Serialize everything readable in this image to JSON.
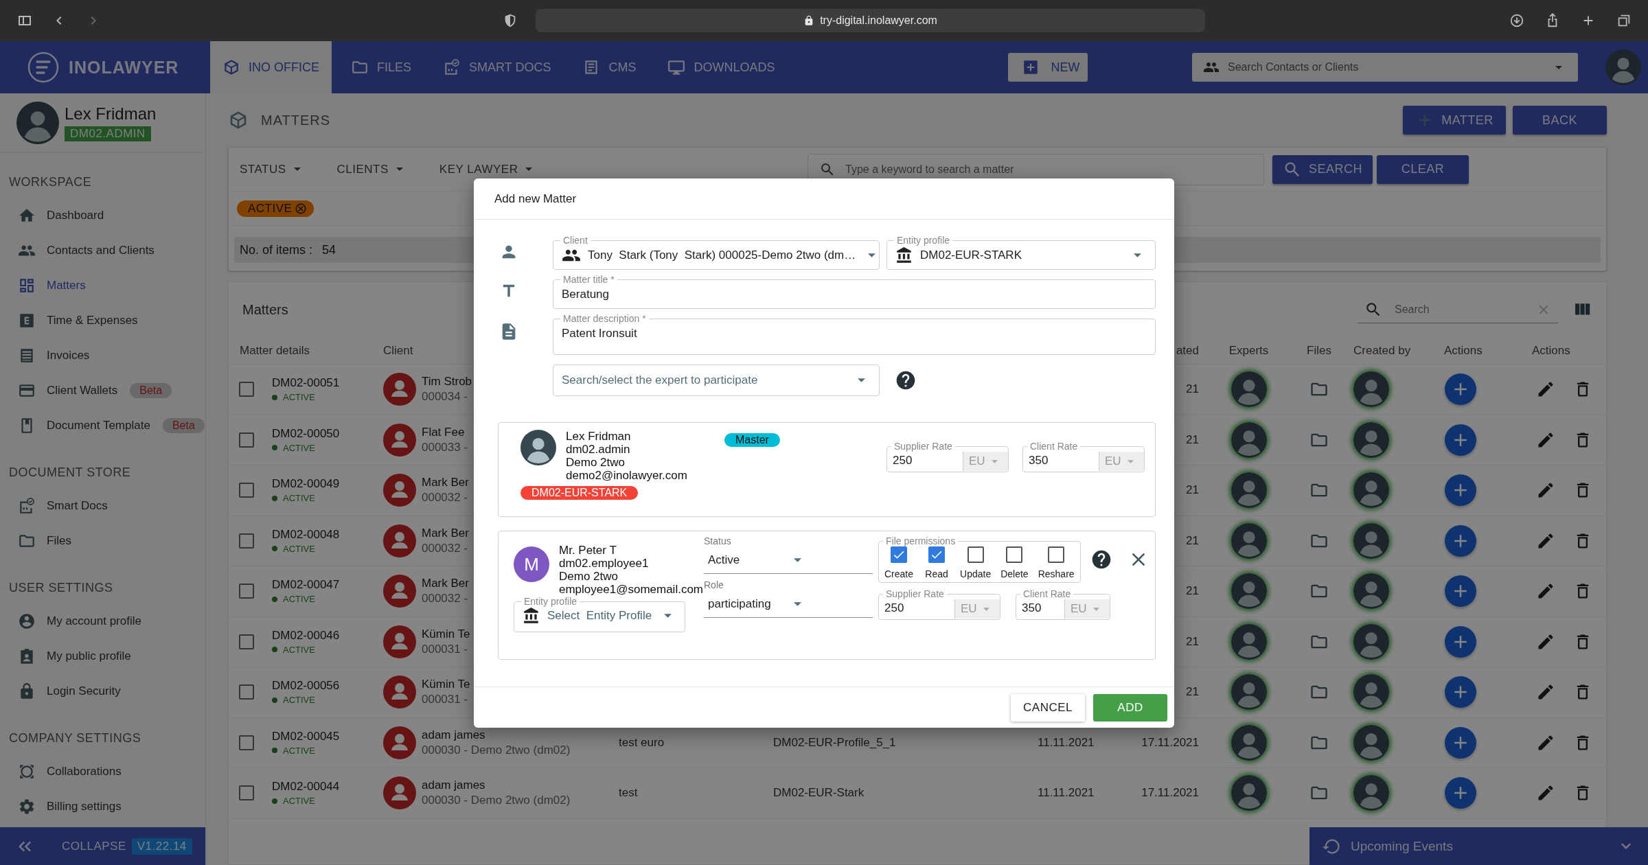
{
  "browser": {
    "url": "try-digital.inolawyer.com"
  },
  "nav": {
    "logo": "INOLAWYER",
    "tabs": [
      {
        "label": "INO OFFICE",
        "selected": true
      },
      {
        "label": "FILES",
        "selected": false
      },
      {
        "label": "SMART DOCS",
        "selected": false
      },
      {
        "label": "CMS",
        "selected": false
      },
      {
        "label": "DOWNLOADS",
        "selected": false
      }
    ],
    "new_button": "NEW",
    "search": {
      "placeholder": "Search Contacts or Clients"
    }
  },
  "sidebar": {
    "user": {
      "name": "Lex Fridman",
      "role": "DM02.ADMIN"
    },
    "sections": [
      {
        "title": "WORKSPACE",
        "items": [
          {
            "label": "Dashboard",
            "selected": false
          },
          {
            "label": "Contacts and Clients",
            "selected": false
          },
          {
            "label": "Matters",
            "selected": true
          },
          {
            "label": "Time & Expenses",
            "selected": false
          },
          {
            "label": "Invoices",
            "selected": false
          },
          {
            "label": "Client Wallets",
            "selected": false,
            "badge": "Beta"
          },
          {
            "label": "Document Template",
            "selected": false,
            "badge": "Beta"
          }
        ]
      },
      {
        "title": "DOCUMENT STORE",
        "items": [
          {
            "label": "Smart Docs",
            "selected": false
          },
          {
            "label": "Files",
            "selected": false
          }
        ]
      },
      {
        "title": "USER SETTINGS",
        "items": [
          {
            "label": "My account profile",
            "selected": false
          },
          {
            "label": "My public profile",
            "selected": false
          },
          {
            "label": "Login Security",
            "selected": false
          }
        ]
      },
      {
        "title": "COMPANY SETTINGS",
        "items": [
          {
            "label": "Collaborations",
            "selected": false
          },
          {
            "label": "Billing settings",
            "selected": false
          }
        ]
      }
    ],
    "collapse": "COLLAPSE",
    "version": "V1.22.14"
  },
  "page": {
    "title": "MATTERS",
    "add_button": "MATTER",
    "back_button": "BACK",
    "filters": [
      "STATUS",
      "CLIENTS",
      "KEY LAWYER"
    ],
    "search": {
      "placeholder": "Type a keyword to search a matter"
    },
    "search_button": "SEARCH",
    "clear_button": "CLEAR",
    "chip": "ACTIVE",
    "count_label": "No. of items :",
    "count": "54"
  },
  "table": {
    "title": "Matters",
    "search": {
      "placeholder": "Search"
    },
    "columns": [
      "Matter details",
      "Client",
      "ated",
      "Experts",
      "Files",
      "Created by",
      "Actions",
      "Actions"
    ],
    "rows": [
      {
        "checked": false,
        "id": "DM02-00051",
        "status": "ACTIVE",
        "client": "Tim Strob",
        "client_sub": "000034 -",
        "column_6": "21"
      },
      {
        "checked": false,
        "id": "DM02-00050",
        "status": "ACTIVE",
        "client": "Flat Fee",
        "client_sub": "000033 -",
        "column_6": "21"
      },
      {
        "checked": false,
        "id": "DM02-00049",
        "status": "ACTIVE",
        "client": "Mark Ber",
        "client_sub": "000032 -",
        "column_6": "21"
      },
      {
        "checked": false,
        "id": "DM02-00048",
        "status": "ACTIVE",
        "client": "Mark Ber",
        "client_sub": "000032 -",
        "column_6": "21"
      },
      {
        "checked": false,
        "id": "DM02-00047",
        "status": "ACTIVE",
        "client": "Mark Ber",
        "client_sub": "000032 -",
        "column_6": "21"
      },
      {
        "checked": false,
        "id": "DM02-00046",
        "status": "ACTIVE",
        "client": "Kümin Te",
        "client_sub": "000031 -",
        "column_6": "21"
      },
      {
        "checked": false,
        "id": "DM02-00056",
        "status": "ACTIVE",
        "client": "Kümin Te",
        "client_sub": "000031 -",
        "column_6": "21"
      },
      {
        "checked": false,
        "id": "DM02-00045",
        "status": "ACTIVE",
        "client": "adam james",
        "client_sub": "000030 - Demo 2two (dm02)",
        "column_3": "test euro",
        "column_4": "DM02-EUR-Profile_5_1",
        "column_5": "11.11.2021",
        "column_6": "17.11.2021"
      },
      {
        "checked": false,
        "id": "DM02-00044",
        "status": "ACTIVE",
        "client": "adam james",
        "client_sub": "000030 - Demo 2two (dm02)",
        "column_3": "test",
        "column_4": "DM02-EUR-Stark",
        "column_5": "11.11.2021",
        "column_6": "17.11.2021"
      }
    ]
  },
  "upcoming_events": "Upcoming Events",
  "modal": {
    "title": "Add new Matter",
    "client": {
      "label": "Client",
      "value": "Tony  Stark (Tony  Stark) 000025-Demo 2two (dm…"
    },
    "entity_profile": {
      "label": "Entity profile",
      "value": "DM02-EUR-STARK"
    },
    "matter_title": {
      "label": "Matter title *",
      "value": "Beratung"
    },
    "description": {
      "label": "Matter description *",
      "value": "Patent Ironsuit"
    },
    "expert_select": {
      "placeholder": "Search/select the expert to participate"
    },
    "master": {
      "name": "Lex Fridman",
      "username": "dm02.admin",
      "org": "Demo 2two",
      "email": "demo2@inolawyer.com",
      "badge": "Master",
      "entity_tag": "DM02-EUR-STARK",
      "supplier_rate": {
        "label": "Supplier Rate",
        "value": "250",
        "currency": "EU"
      },
      "client_rate": {
        "label": "Client Rate",
        "value": "350",
        "currency": "EU"
      }
    },
    "member": {
      "initial": "M",
      "name": "Mr. Peter T",
      "username": "dm02.employee1",
      "org": "Demo 2two",
      "email": "employee1@somemail.com",
      "entity_profile": {
        "label": "Entity profile",
        "placeholder": "Select  Entity Profile"
      },
      "status": {
        "label": "Status",
        "value": "Active"
      },
      "role": {
        "label": "Role",
        "value": "participating"
      },
      "permissions": {
        "label": "File permissions",
        "items": [
          {
            "label": "Create",
            "checked": true
          },
          {
            "label": "Read",
            "checked": true
          },
          {
            "label": "Update",
            "checked": false
          },
          {
            "label": "Delete",
            "checked": false
          },
          {
            "label": "Reshare",
            "checked": false
          }
        ]
      },
      "supplier_rate": {
        "label": "Supplier Rate",
        "value": "250",
        "currency": "EU"
      },
      "client_rate": {
        "label": "Client Rate",
        "value": "350",
        "currency": "EU"
      }
    },
    "cancel_button": "CANCEL",
    "add_button": "ADD"
  }
}
